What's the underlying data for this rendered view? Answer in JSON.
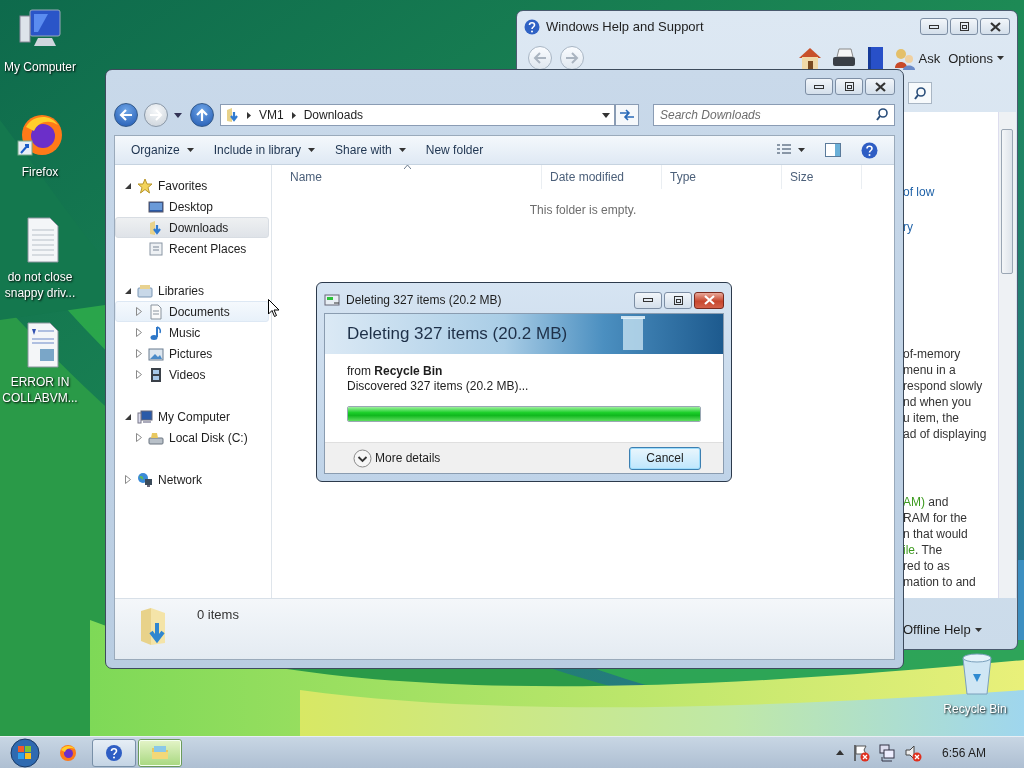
{
  "desktop_icons": [
    {
      "label": "My Computer",
      "kind": "computer"
    },
    {
      "label": "Firefox",
      "kind": "firefox"
    },
    {
      "label": "do not close snappy driv...",
      "kind": "text-file"
    },
    {
      "label": "ERROR IN COLLABVM...",
      "kind": "document"
    },
    {
      "label": "Recycle Bin",
      "kind": "recycle-bin"
    }
  ],
  "help_window": {
    "title": "Windows Help and Support",
    "ask_label": "Ask",
    "options_label": "Options",
    "footer_label": "Offline Help",
    "paragraphs": [
      {
        "lines": [
          [
            {
              "text": "of low",
              "kind": "link"
            }
          ]
        ]
      },
      {
        "lines": [
          [
            {
              "text": "ry",
              "kind": "link"
            }
          ]
        ]
      },
      {
        "lines": [
          [
            {
              "text": "of-memory",
              "kind": "text"
            }
          ],
          [
            {
              "text": "menu in a",
              "kind": "text"
            }
          ],
          [
            {
              "text": "respond slowly",
              "kind": "text"
            }
          ],
          [
            {
              "text": "nd when you",
              "kind": "text"
            }
          ],
          [
            {
              "text": "u item, the",
              "kind": "text"
            }
          ],
          [
            {
              "text": "ad of displaying",
              "kind": "text"
            }
          ]
        ]
      },
      {
        "lines": [
          [
            {
              "text": "AM)",
              "kind": "term"
            },
            {
              "text": " and",
              "kind": "text"
            }
          ],
          [
            {
              "text": "RAM for the",
              "kind": "text"
            }
          ],
          [
            {
              "text": "n that would",
              "kind": "text"
            }
          ],
          [
            {
              "text": "ile",
              "kind": "term"
            },
            {
              "text": ". The",
              "kind": "text"
            }
          ],
          [
            {
              "text": "red to as",
              "kind": "text"
            }
          ],
          [
            {
              "text": "mation to and",
              "kind": "text"
            }
          ]
        ]
      }
    ]
  },
  "explorer": {
    "breadcrumb": [
      "VM1",
      "Downloads"
    ],
    "search": {
      "placeholder": "Search Downloads"
    },
    "toolbar": [
      {
        "label": "Organize",
        "dropdown": true
      },
      {
        "label": "Include in library",
        "dropdown": true
      },
      {
        "label": "Share with",
        "dropdown": true
      },
      {
        "label": "New folder",
        "dropdown": false
      }
    ],
    "nav": [
      {
        "label": "Favorites",
        "kind": "favorites",
        "expanded": true,
        "selected": false,
        "children": [
          {
            "label": "Desktop",
            "kind": "desktop",
            "selected": false,
            "hovered": false
          },
          {
            "label": "Downloads",
            "kind": "downloads",
            "selected": true,
            "hovered": false
          },
          {
            "label": "Recent Places",
            "kind": "recent",
            "selected": false,
            "hovered": false
          }
        ]
      },
      {
        "label": "Libraries",
        "kind": "libraries",
        "expanded": true,
        "selected": false,
        "children": [
          {
            "label": "Documents",
            "kind": "documents",
            "selected": false,
            "hovered": true,
            "expanded": false
          },
          {
            "label": "Music",
            "kind": "music",
            "selected": false,
            "hovered": false,
            "expanded": false
          },
          {
            "label": "Pictures",
            "kind": "pictures",
            "selected": false,
            "hovered": false,
            "expanded": false
          },
          {
            "label": "Videos",
            "kind": "videos",
            "selected": false,
            "hovered": false,
            "expanded": false
          }
        ]
      },
      {
        "label": "My Computer",
        "kind": "computer",
        "expanded": true,
        "selected": false,
        "children": [
          {
            "label": "Local Disk (C:)",
            "kind": "disk",
            "selected": false,
            "hovered": false,
            "expanded": false
          }
        ]
      },
      {
        "label": "Network",
        "kind": "network",
        "expanded": false,
        "selected": false
      }
    ],
    "columns": [
      {
        "label": "Name",
        "sorted": true
      },
      {
        "label": "Date modified",
        "sorted": false
      },
      {
        "label": "Type",
        "sorted": false
      },
      {
        "label": "Size",
        "sorted": false
      }
    ],
    "empty_message": "This folder is empty.",
    "status": "0 items"
  },
  "dialog": {
    "title": "Deleting 327 items (20.2 MB)",
    "heading": "Deleting 327 items (20.2 MB)",
    "source": "from **Recycle Bin**",
    "status": "Discovered 327 items (20.2 MB)...",
    "progress": {
      "level": 1
    },
    "more_details": "More details",
    "cancel": "Cancel"
  },
  "taskbar": {
    "items": [
      {
        "kind": "firefox",
        "running": false,
        "active": false
      },
      {
        "kind": "help",
        "running": true,
        "active": false
      },
      {
        "kind": "explorer",
        "running": true,
        "active": true
      }
    ],
    "clock": "6:56 AM"
  }
}
